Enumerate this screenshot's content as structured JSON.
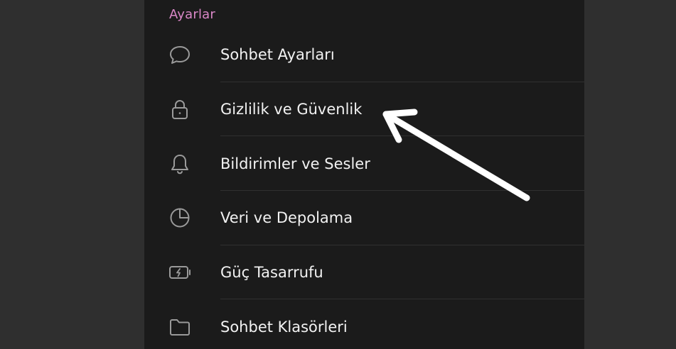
{
  "settings": {
    "section_title": "Ayarlar",
    "accent_color": "#d987c7",
    "items": [
      {
        "label": "Sohbet Ayarları",
        "icon": "chat-bubble-icon"
      },
      {
        "label": "Gizlilik ve Güvenlik",
        "icon": "lock-icon"
      },
      {
        "label": "Bildirimler ve Sesler",
        "icon": "bell-icon"
      },
      {
        "label": "Veri ve Depolama",
        "icon": "pie-chart-icon"
      },
      {
        "label": "Güç Tasarrufu",
        "icon": "battery-charging-icon"
      },
      {
        "label": "Sohbet Klasörleri",
        "icon": "folder-icon"
      }
    ]
  },
  "annotation": {
    "icon": "arrow-icon",
    "color": "#ffffff",
    "points_to": "Gizlilik ve Güvenlik"
  }
}
